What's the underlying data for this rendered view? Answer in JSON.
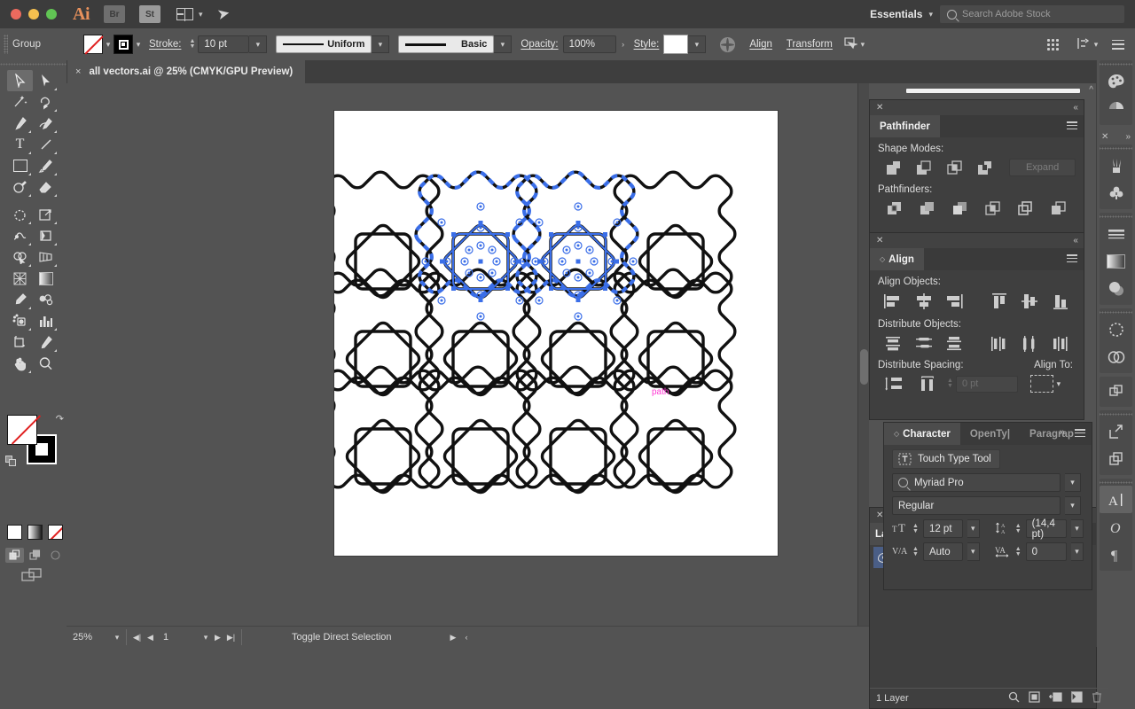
{
  "app": {
    "name": "Ai",
    "workspace": "Essentials",
    "search_placeholder": "Search Adobe Stock",
    "launch_buttons": [
      {
        "label": "Br",
        "name": "bridge-button"
      },
      {
        "label": "St",
        "name": "stock-button"
      }
    ]
  },
  "control_bar": {
    "selection_label": "Group",
    "fill_label": "Fill",
    "stroke_label": "Stroke:",
    "stroke_weight": "10 pt",
    "stroke_profile": "Uniform",
    "brush_definition": "Basic",
    "opacity_label": "Opacity:",
    "opacity_value": "100%",
    "style_label": "Style:",
    "align_label": "Align",
    "transform_label": "Transform",
    "more_label": "›"
  },
  "document": {
    "tab_title": "all vectors.ai @ 25% (CMYK/GPU Preview)",
    "close_glyph": "×"
  },
  "tools": {
    "items": [
      {
        "name": "selection-tool",
        "glyph": "selection",
        "selected": true
      },
      {
        "name": "direct-selection-tool",
        "glyph": "direct-selection",
        "selected": false
      },
      {
        "name": "magic-wand-tool",
        "glyph": "magic-wand",
        "selected": false
      },
      {
        "name": "lasso-tool",
        "glyph": "lasso",
        "selected": false
      },
      {
        "name": "pen-tool",
        "glyph": "pen",
        "selected": false
      },
      {
        "name": "curvature-tool",
        "glyph": "curvature",
        "selected": false
      },
      {
        "name": "type-tool",
        "glyph": "type",
        "selected": false
      },
      {
        "name": "line-segment-tool",
        "glyph": "line",
        "selected": false
      },
      {
        "name": "rectangle-tool",
        "glyph": "rectangle",
        "selected": false
      },
      {
        "name": "paintbrush-tool",
        "glyph": "paintbrush",
        "selected": false
      },
      {
        "name": "shaper-tool",
        "glyph": "shaper",
        "selected": false
      },
      {
        "name": "eraser-tool",
        "glyph": "eraser",
        "selected": false
      },
      {
        "name": "rotate-tool",
        "glyph": "rotate",
        "selected": false
      },
      {
        "name": "scale-tool",
        "glyph": "scale",
        "selected": false
      },
      {
        "name": "width-tool",
        "glyph": "width",
        "selected": false
      },
      {
        "name": "free-transform-tool",
        "glyph": "free-transform",
        "selected": false
      },
      {
        "name": "shape-builder-tool",
        "glyph": "shape-builder",
        "selected": false
      },
      {
        "name": "perspective-grid-tool",
        "glyph": "perspective-grid",
        "selected": false
      },
      {
        "name": "mesh-tool",
        "glyph": "mesh",
        "selected": false
      },
      {
        "name": "gradient-tool",
        "glyph": "gradient",
        "selected": false
      },
      {
        "name": "eyedropper-tool",
        "glyph": "eyedropper",
        "selected": false
      },
      {
        "name": "blend-tool",
        "glyph": "blend",
        "selected": false
      },
      {
        "name": "symbol-sprayer-tool",
        "glyph": "symbol-sprayer",
        "selected": false
      },
      {
        "name": "column-graph-tool",
        "glyph": "column-graph",
        "selected": false
      },
      {
        "name": "artboard-tool",
        "glyph": "artboard",
        "selected": false
      },
      {
        "name": "slice-tool",
        "glyph": "slice",
        "selected": false
      },
      {
        "name": "hand-tool",
        "glyph": "hand",
        "selected": false
      },
      {
        "name": "zoom-tool",
        "glyph": "zoom",
        "selected": false
      }
    ],
    "fill_state": "none",
    "stroke_state": "black",
    "color_modes": [
      "color",
      "gradient",
      "none"
    ],
    "draw_modes": [
      "draw-normal",
      "draw-behind",
      "draw-inside"
    ],
    "draw_mode_active": "draw-normal"
  },
  "canvas": {
    "smart_guide_label": "path",
    "smart_guide_color": "#ff3bd4",
    "selection_color": "#3a6ee8",
    "artwork_description": "4 by 3 grid of octagonal rosette motifs",
    "grid_cols": 4,
    "grid_rows": 3,
    "selected_cells": [
      1,
      2
    ]
  },
  "pathfinder": {
    "tab_label": "Pathfinder",
    "shape_modes_label": "Shape Modes:",
    "pathfinders_label": "Pathfinders:",
    "expand_label": "Expand",
    "shape_mode_buttons": [
      {
        "name": "unite-button"
      },
      {
        "name": "minus-front-button"
      },
      {
        "name": "intersect-button"
      },
      {
        "name": "exclude-button"
      }
    ],
    "pathfinder_buttons": [
      {
        "name": "divide-button"
      },
      {
        "name": "trim-button"
      },
      {
        "name": "merge-button"
      },
      {
        "name": "crop-button"
      },
      {
        "name": "outline-button"
      },
      {
        "name": "minus-back-button"
      }
    ]
  },
  "align": {
    "tab_label": "Align",
    "align_objects_label": "Align Objects:",
    "distribute_objects_label": "Distribute Objects:",
    "distribute_spacing_label": "Distribute Spacing:",
    "align_to_label": "Align To:",
    "spacing_value": "0 pt",
    "align_buttons": [
      {
        "name": "align-left-button"
      },
      {
        "name": "align-horizontal-center-button"
      },
      {
        "name": "align-right-button"
      },
      {
        "name": "align-top-button"
      },
      {
        "name": "align-vertical-center-button"
      },
      {
        "name": "align-bottom-button"
      }
    ],
    "distribute_buttons": [
      {
        "name": "distribute-vertical-top-button"
      },
      {
        "name": "distribute-vertical-center-button"
      },
      {
        "name": "distribute-vertical-bottom-button"
      },
      {
        "name": "distribute-horizontal-left-button"
      },
      {
        "name": "distribute-horizontal-center-button"
      },
      {
        "name": "distribute-horizontal-right-button"
      }
    ],
    "spacing_buttons": [
      {
        "name": "vertical-distribute-space-button"
      },
      {
        "name": "horizontal-distribute-space-button"
      }
    ]
  },
  "character": {
    "tabs": [
      {
        "label": "Character",
        "active": true
      },
      {
        "label": "OpenTy|",
        "active": false
      },
      {
        "label": "Paragraр",
        "active": false
      }
    ],
    "overflow_glyph": "»",
    "touch_type_label": "Touch Type Tool",
    "font_family": "Myriad Pro",
    "font_style": "Regular",
    "font_size": "12 pt",
    "leading": "(14,4 pt)",
    "kerning": "Auto",
    "tracking": "0"
  },
  "layers": {
    "tab_label": "La",
    "status": "1 Layer",
    "footer_icons": [
      {
        "name": "locate-object-icon"
      },
      {
        "name": "make-clipping-mask-icon"
      },
      {
        "name": "create-new-sublayer-icon"
      },
      {
        "name": "create-new-layer-icon"
      },
      {
        "name": "delete-selection-icon"
      }
    ]
  },
  "status_bar": {
    "zoom_level": "25%",
    "page_number": "1",
    "tool_status": "Toggle Direct Selection"
  },
  "rail": {
    "groups": [
      {
        "icons": [
          {
            "name": "color-panel-icon"
          },
          {
            "name": "color-guide-panel-icon"
          }
        ]
      },
      {
        "icons": [
          {
            "name": "brushes-panel-icon"
          },
          {
            "name": "symbols-panel-icon"
          }
        ]
      },
      {
        "icons": [
          {
            "name": "stroke-panel-icon"
          },
          {
            "name": "gradient-panel-icon"
          },
          {
            "name": "transparency-panel-icon"
          }
        ]
      },
      {
        "icons": [
          {
            "name": "appearance-panel-icon"
          },
          {
            "name": "graphic-styles-panel-icon"
          }
        ]
      },
      {
        "icons": [
          {
            "name": "pathfinder-panel-icon"
          }
        ]
      },
      {
        "icons": [
          {
            "name": "export-panel-icon"
          },
          {
            "name": "asset-export-panel-icon"
          }
        ]
      },
      {
        "icons": [
          {
            "name": "character-panel-icon"
          },
          {
            "name": "opentype-panel-icon"
          },
          {
            "name": "paragraph-panel-icon"
          }
        ]
      }
    ]
  }
}
